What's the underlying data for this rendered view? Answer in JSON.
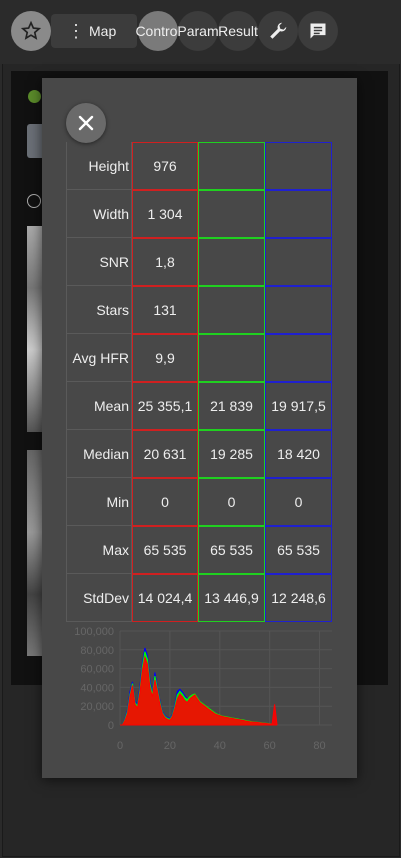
{
  "toolbar": {
    "menu_label": "Map",
    "tabs": [
      "Control",
      "Param",
      "Result"
    ],
    "icons": [
      "star-icon",
      "more-vert-icon",
      "wrench-icon",
      "chat-icon"
    ]
  },
  "stats": {
    "rows": [
      {
        "label": "Height",
        "r": "976",
        "g": "",
        "b": ""
      },
      {
        "label": "Width",
        "r": "1 304",
        "g": "",
        "b": ""
      },
      {
        "label": "SNR",
        "r": "1,8",
        "g": "",
        "b": ""
      },
      {
        "label": "Stars",
        "r": "131",
        "g": "",
        "b": ""
      },
      {
        "label": "Avg HFR",
        "r": "9,9",
        "g": "",
        "b": ""
      },
      {
        "label": "Mean",
        "r": "25 355,1",
        "g": "21 839",
        "b": "19 917,5"
      },
      {
        "label": "Median",
        "r": "20 631",
        "g": "19 285",
        "b": "18 420"
      },
      {
        "label": "Min",
        "r": "0",
        "g": "0",
        "b": "0"
      },
      {
        "label": "Max",
        "r": "65 535",
        "g": "65 535",
        "b": "65 535"
      },
      {
        "label": "StdDev",
        "r": "14 024,4",
        "g": "13 446,9",
        "b": "12 248,6"
      }
    ]
  },
  "colors": {
    "red": "#ff0000",
    "green": "#00ff00",
    "blue": "#0000ff"
  },
  "chart_data": {
    "type": "area",
    "title": "",
    "xlabel": "",
    "ylabel": "",
    "x_ticks": [
      "0",
      "20",
      "40",
      "60",
      "80"
    ],
    "y_ticks": [
      "0",
      "20,000",
      "40,000",
      "60,000",
      "80,000",
      "100,000"
    ],
    "xlim": [
      0,
      85
    ],
    "ylim": [
      0,
      100000
    ],
    "grid": true,
    "x": [
      0,
      1,
      2,
      3,
      4,
      5,
      6,
      7,
      8,
      9,
      10,
      11,
      12,
      13,
      14,
      15,
      16,
      17,
      18,
      19,
      20,
      21,
      22,
      23,
      24,
      25,
      26,
      27,
      28,
      29,
      30,
      31,
      32,
      33,
      34,
      35,
      36,
      37,
      38,
      39,
      40,
      41,
      42,
      43,
      44,
      45,
      46,
      47,
      48,
      49,
      50,
      51,
      52,
      53,
      54,
      55,
      56,
      57,
      58,
      59,
      60,
      61,
      62,
      63
    ],
    "series": [
      {
        "values": [
          0,
          0,
          5000,
          12000,
          30000,
          42000,
          22000,
          18000,
          35000,
          58000,
          72000,
          65000,
          40000,
          30000,
          48000,
          36000,
          22000,
          12000,
          8000,
          6000,
          5000,
          9000,
          18000,
          28000,
          33000,
          30000,
          26000,
          24000,
          28000,
          30000,
          32000,
          28000,
          24000,
          22000,
          20000,
          18000,
          16000,
          14000,
          12000,
          11000,
          10000,
          9000,
          8500,
          8000,
          7500,
          7000,
          6500,
          6000,
          5500,
          5000,
          4500,
          4000,
          3500,
          3200,
          3000,
          2800,
          2500,
          2000,
          1800,
          1500,
          1200,
          1000,
          22000,
          0
        ]
      },
      {
        "values": [
          0,
          0,
          6000,
          14000,
          32000,
          44000,
          24000,
          20000,
          38000,
          62000,
          78000,
          70000,
          44000,
          32000,
          52000,
          38000,
          24000,
          13000,
          9000,
          7000,
          6000,
          10000,
          20000,
          32000,
          36000,
          33000,
          29000,
          27000,
          30000,
          32000,
          33000,
          29000,
          25000,
          23000,
          21000,
          19000,
          17000,
          15000,
          13000,
          11500,
          10500,
          9500,
          9000,
          8500,
          8000,
          7500,
          7000,
          6500,
          6000,
          5500,
          5000,
          4500,
          4000,
          3500,
          3200,
          3000,
          2700,
          2200,
          2000,
          1700,
          1400,
          1100,
          0,
          0
        ]
      },
      {
        "values": [
          0,
          0,
          7000,
          16000,
          36000,
          46000,
          26000,
          22000,
          42000,
          66000,
          82000,
          74000,
          48000,
          34000,
          56000,
          40000,
          26000,
          14000,
          10000,
          8000,
          7000,
          11000,
          22000,
          36000,
          38000,
          35000,
          31000,
          28000,
          29000,
          30000,
          30000,
          27000,
          24000,
          22000,
          20000,
          18000,
          16000,
          14000,
          12500,
          11000,
          10000,
          9000,
          8500,
          8000,
          7500,
          7000,
          6500,
          6000,
          5500,
          5000,
          4500,
          4000,
          3500,
          3000,
          2800,
          2600,
          2300,
          1900,
          1700,
          1400,
          1100,
          900,
          0,
          0
        ]
      }
    ]
  }
}
